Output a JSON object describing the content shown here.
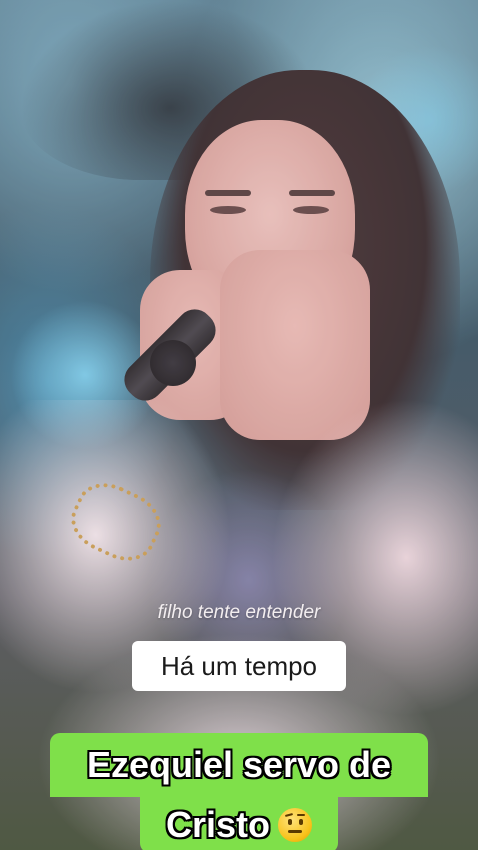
{
  "video": {
    "lyrics": {
      "previous_line": "filho tente entender",
      "current_line": "Há um tempo"
    },
    "caption": {
      "line1": "Ezequiel servo de",
      "line2": "Cristo",
      "emoji": "thinking-face-emoji",
      "background_color": "#7fe04a"
    }
  }
}
